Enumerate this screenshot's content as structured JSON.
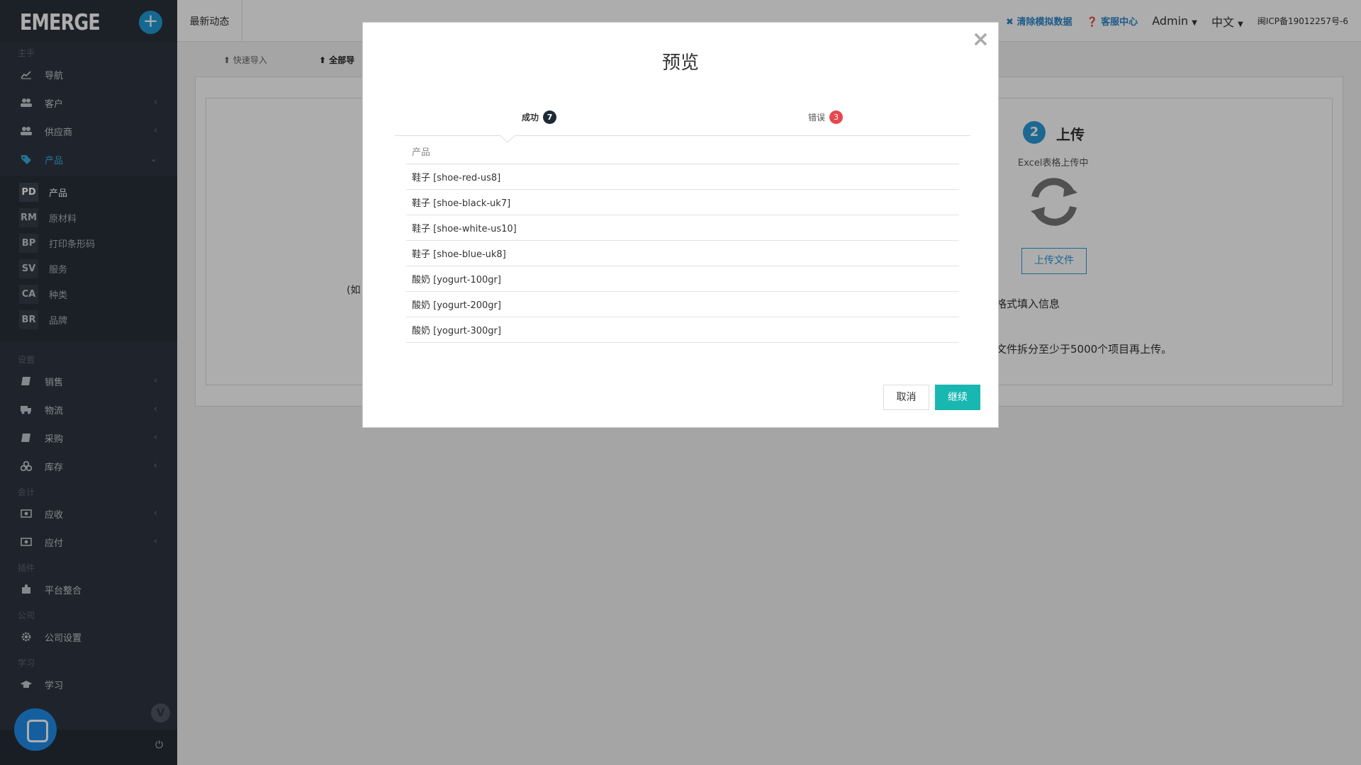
{
  "sidebar": {
    "logo": "EMERGE",
    "add_symbol": "+",
    "sections": {
      "assistant": "主手",
      "settings": "设置",
      "accounting": "会计",
      "plugins": "插件",
      "company": "公司",
      "learning": "学习"
    },
    "items": {
      "navigation": "导航",
      "customers": "客户",
      "suppliers": "供应商",
      "products": "产品",
      "sales": "销售",
      "logistics": "物流",
      "purchasing": "采购",
      "inventory": "库存",
      "receivable": "应收",
      "payable": "应付",
      "integration": "平台整合",
      "company_settings": "公司设置",
      "learn": "学习"
    },
    "product_submenu": [
      {
        "abbr": "PD",
        "label": "产品"
      },
      {
        "abbr": "RM",
        "label": "原材料"
      },
      {
        "abbr": "BP",
        "label": "打印条形码"
      },
      {
        "abbr": "SV",
        "label": "服务"
      },
      {
        "abbr": "CA",
        "label": "种类"
      },
      {
        "abbr": "BR",
        "label": "品牌"
      }
    ],
    "v_badge": "V",
    "power_symbol": "⏻"
  },
  "topbar": {
    "latest": "最新动态",
    "clear_demo": "清除模拟数据",
    "support": "客服中心",
    "user": "Admin",
    "language": "中文",
    "icp": "闽ICP备19012257号-6"
  },
  "main": {
    "tabs": {
      "quick_import": "快速导入",
      "full_import": "全部导"
    },
    "step_number": "2",
    "step_title": "上传",
    "step_subtitle": "Excel表格上传中",
    "upload_button": "上传文件",
    "bg_text_format": "格式填入信息",
    "bg_text_split": "文件拆分至少于5000个项目再上传。",
    "bg_text_left": "(如"
  },
  "modal": {
    "title": "预览",
    "close_symbol": "×",
    "tabs": {
      "success_label": "成功",
      "success_count": "7",
      "error_label": "错误",
      "error_count": "3"
    },
    "table": {
      "header": "产品",
      "rows": [
        "鞋子 [shoe-red-us8]",
        "鞋子 [shoe-black-uk7]",
        "鞋子 [shoe-white-us10]",
        "鞋子 [shoe-blue-uk8]",
        "酸奶 [yogurt-100gr]",
        "酸奶 [yogurt-200gr]",
        "酸奶 [yogurt-300gr]"
      ]
    },
    "cancel": "取消",
    "continue": "继续"
  },
  "colors": {
    "sidebar_bg": "#2e3641",
    "accent_blue": "#2c9ad8",
    "teal_button": "#18b7b0",
    "error_badge": "#e5484d"
  }
}
